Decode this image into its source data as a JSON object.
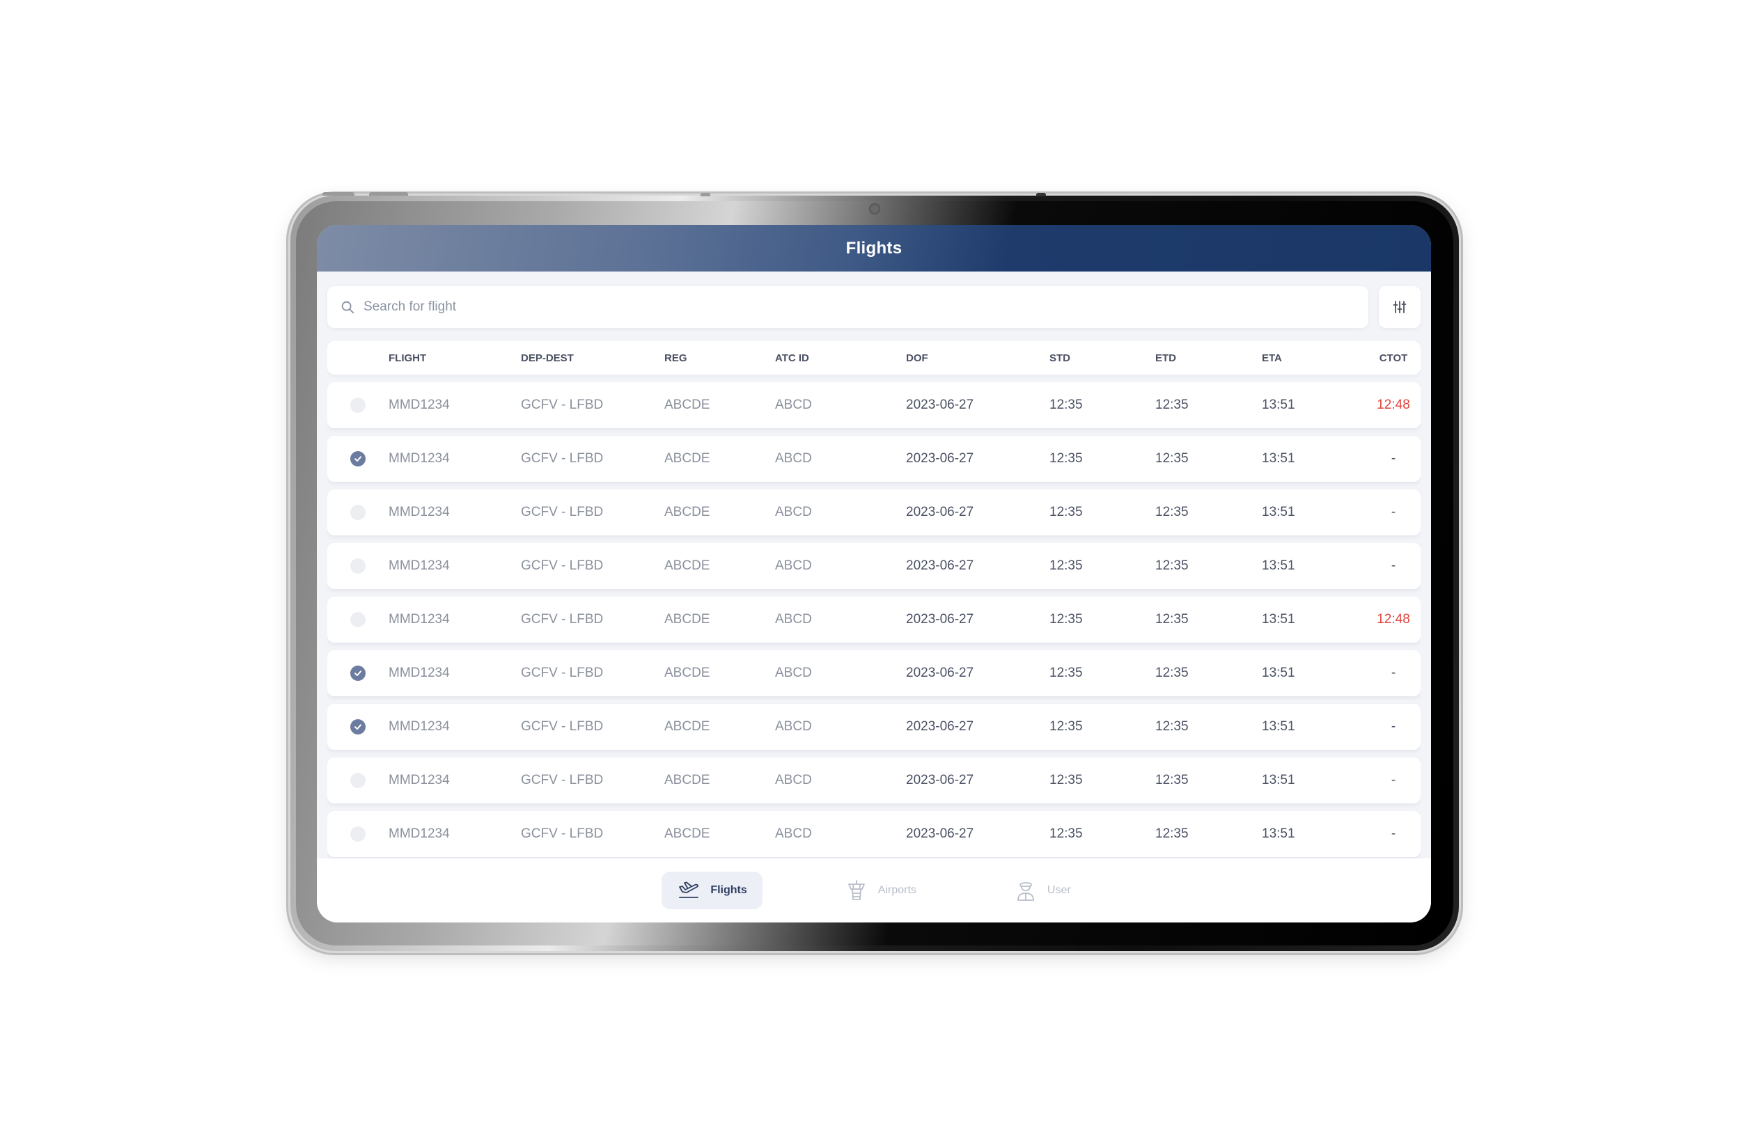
{
  "header": {
    "title": "Flights"
  },
  "search": {
    "placeholder": "Search for flight",
    "value": ""
  },
  "table": {
    "columns": [
      "FLIGHT",
      "DEP-DEST",
      "REG",
      "ATC ID",
      "DOF",
      "STD",
      "ETD",
      "ETA",
      "CTOT"
    ],
    "rows": [
      {
        "selected": false,
        "flight": "MMD1234",
        "dep_dest": "GCFV - LFBD",
        "reg": "ABCDE",
        "atc_id": "ABCD",
        "dof": "2023-06-27",
        "std": "12:35",
        "etd": "12:35",
        "eta": "13:51",
        "ctot": "12:48",
        "ctot_alert": true
      },
      {
        "selected": true,
        "flight": "MMD1234",
        "dep_dest": "GCFV - LFBD",
        "reg": "ABCDE",
        "atc_id": "ABCD",
        "dof": "2023-06-27",
        "std": "12:35",
        "etd": "12:35",
        "eta": "13:51",
        "ctot": "-",
        "ctot_alert": false
      },
      {
        "selected": false,
        "flight": "MMD1234",
        "dep_dest": "GCFV - LFBD",
        "reg": "ABCDE",
        "atc_id": "ABCD",
        "dof": "2023-06-27",
        "std": "12:35",
        "etd": "12:35",
        "eta": "13:51",
        "ctot": "-",
        "ctot_alert": false
      },
      {
        "selected": false,
        "flight": "MMD1234",
        "dep_dest": "GCFV - LFBD",
        "reg": "ABCDE",
        "atc_id": "ABCD",
        "dof": "2023-06-27",
        "std": "12:35",
        "etd": "12:35",
        "eta": "13:51",
        "ctot": "-",
        "ctot_alert": false
      },
      {
        "selected": false,
        "flight": "MMD1234",
        "dep_dest": "GCFV - LFBD",
        "reg": "ABCDE",
        "atc_id": "ABCD",
        "dof": "2023-06-27",
        "std": "12:35",
        "etd": "12:35",
        "eta": "13:51",
        "ctot": "12:48",
        "ctot_alert": true
      },
      {
        "selected": true,
        "flight": "MMD1234",
        "dep_dest": "GCFV - LFBD",
        "reg": "ABCDE",
        "atc_id": "ABCD",
        "dof": "2023-06-27",
        "std": "12:35",
        "etd": "12:35",
        "eta": "13:51",
        "ctot": "-",
        "ctot_alert": false
      },
      {
        "selected": true,
        "flight": "MMD1234",
        "dep_dest": "GCFV - LFBD",
        "reg": "ABCDE",
        "atc_id": "ABCD",
        "dof": "2023-06-27",
        "std": "12:35",
        "etd": "12:35",
        "eta": "13:51",
        "ctot": "-",
        "ctot_alert": false
      },
      {
        "selected": false,
        "flight": "MMD1234",
        "dep_dest": "GCFV - LFBD",
        "reg": "ABCDE",
        "atc_id": "ABCD",
        "dof": "2023-06-27",
        "std": "12:35",
        "etd": "12:35",
        "eta": "13:51",
        "ctot": "-",
        "ctot_alert": false
      },
      {
        "selected": false,
        "flight": "MMD1234",
        "dep_dest": "GCFV - LFBD",
        "reg": "ABCDE",
        "atc_id": "ABCD",
        "dof": "2023-06-27",
        "std": "12:35",
        "etd": "12:35",
        "eta": "13:51",
        "ctot": "-",
        "ctot_alert": false
      }
    ]
  },
  "nav": {
    "items": [
      {
        "label": "Flights",
        "icon": "airplane-icon",
        "active": true
      },
      {
        "label": "Airports",
        "icon": "control-tower-icon",
        "active": false
      },
      {
        "label": "User",
        "icon": "pilot-icon",
        "active": false
      }
    ]
  },
  "colors": {
    "header_dark": "#1a3767",
    "header_light": "#7e8ca6",
    "accent": "#6c7ba0",
    "alert": "#e2453f",
    "background": "#f2f4f8"
  }
}
